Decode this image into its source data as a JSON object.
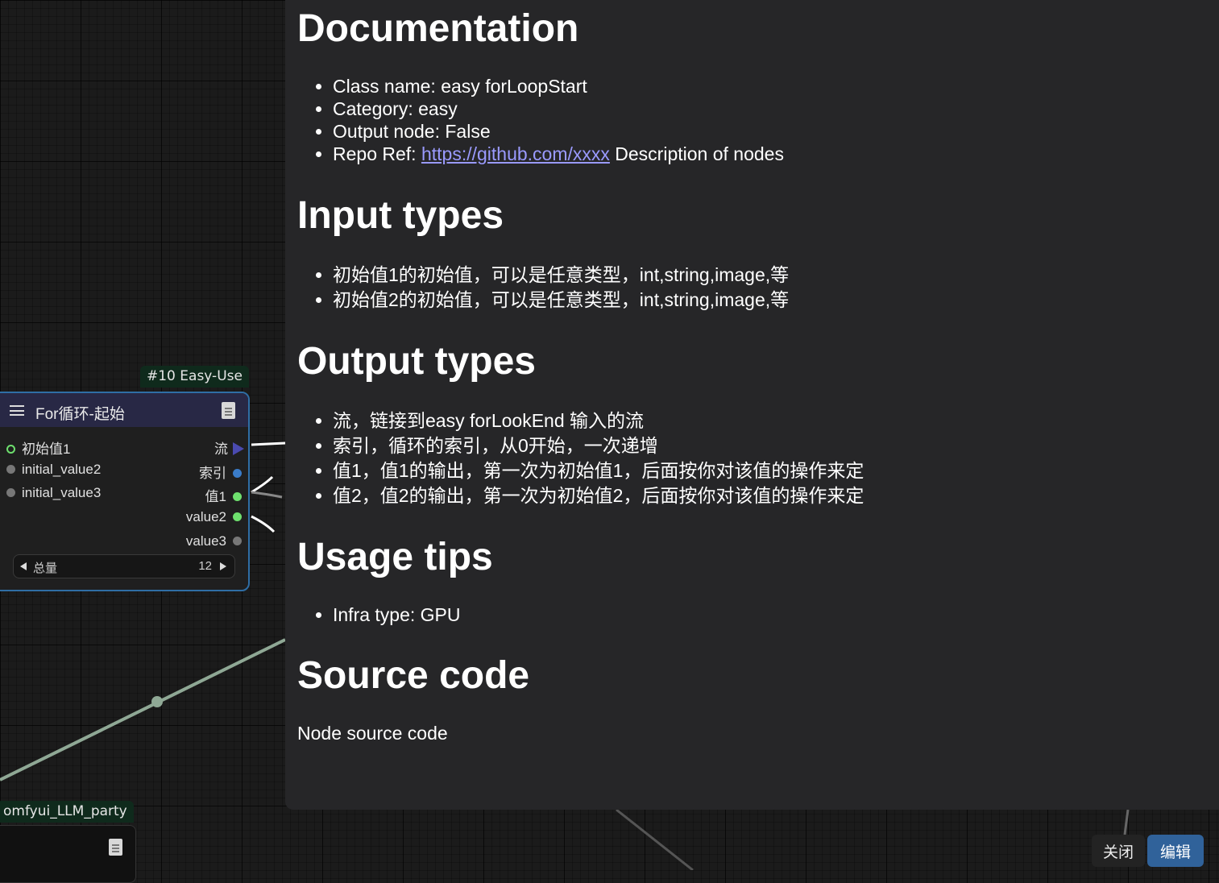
{
  "canvas": {
    "colors": {
      "background": "#1b1b1b",
      "link_green": "#8fa895",
      "panel": "#262628"
    }
  },
  "node_main": {
    "badge": "#10 Easy-Use",
    "title": "For循环-起始",
    "inputs": [
      "初始值1",
      "initial_value2",
      "initial_value3"
    ],
    "outputs": [
      "流",
      "索引",
      "值1",
      "value2",
      "value3"
    ],
    "widget": {
      "label": "总量",
      "value": "12"
    }
  },
  "node_secondary": {
    "badge": "omfyui_LLM_party"
  },
  "doc": {
    "h_documentation": "Documentation",
    "class_name": "Class name: easy forLoopStart",
    "category": "Category: easy",
    "output_node": "Output node: False",
    "repo_prefix": "Repo Ref: ",
    "repo_link": "https://github.com/xxxx",
    "repo_suffix": " Description of nodes",
    "h_input": "Input types",
    "inputs": [
      "初始值1的初始值，可以是任意类型，int,string,image,等",
      "初始值2的初始值，可以是任意类型，int,string,image,等"
    ],
    "h_output": "Output types",
    "outputs": [
      "流，链接到easy forLookEnd 输入的流",
      "索引，循环的索引，从0开始，一次递增",
      "值1，值1的输出，第一次为初始值1，后面按你对该值的操作来定",
      "值2，值2的输出，第一次为初始值2，后面按你对该值的操作来定"
    ],
    "h_usage": "Usage tips",
    "usage": "Infra type: GPU",
    "h_source": "Source code",
    "source": "Node source code"
  },
  "buttons": {
    "close": "关闭",
    "edit": "编辑"
  }
}
